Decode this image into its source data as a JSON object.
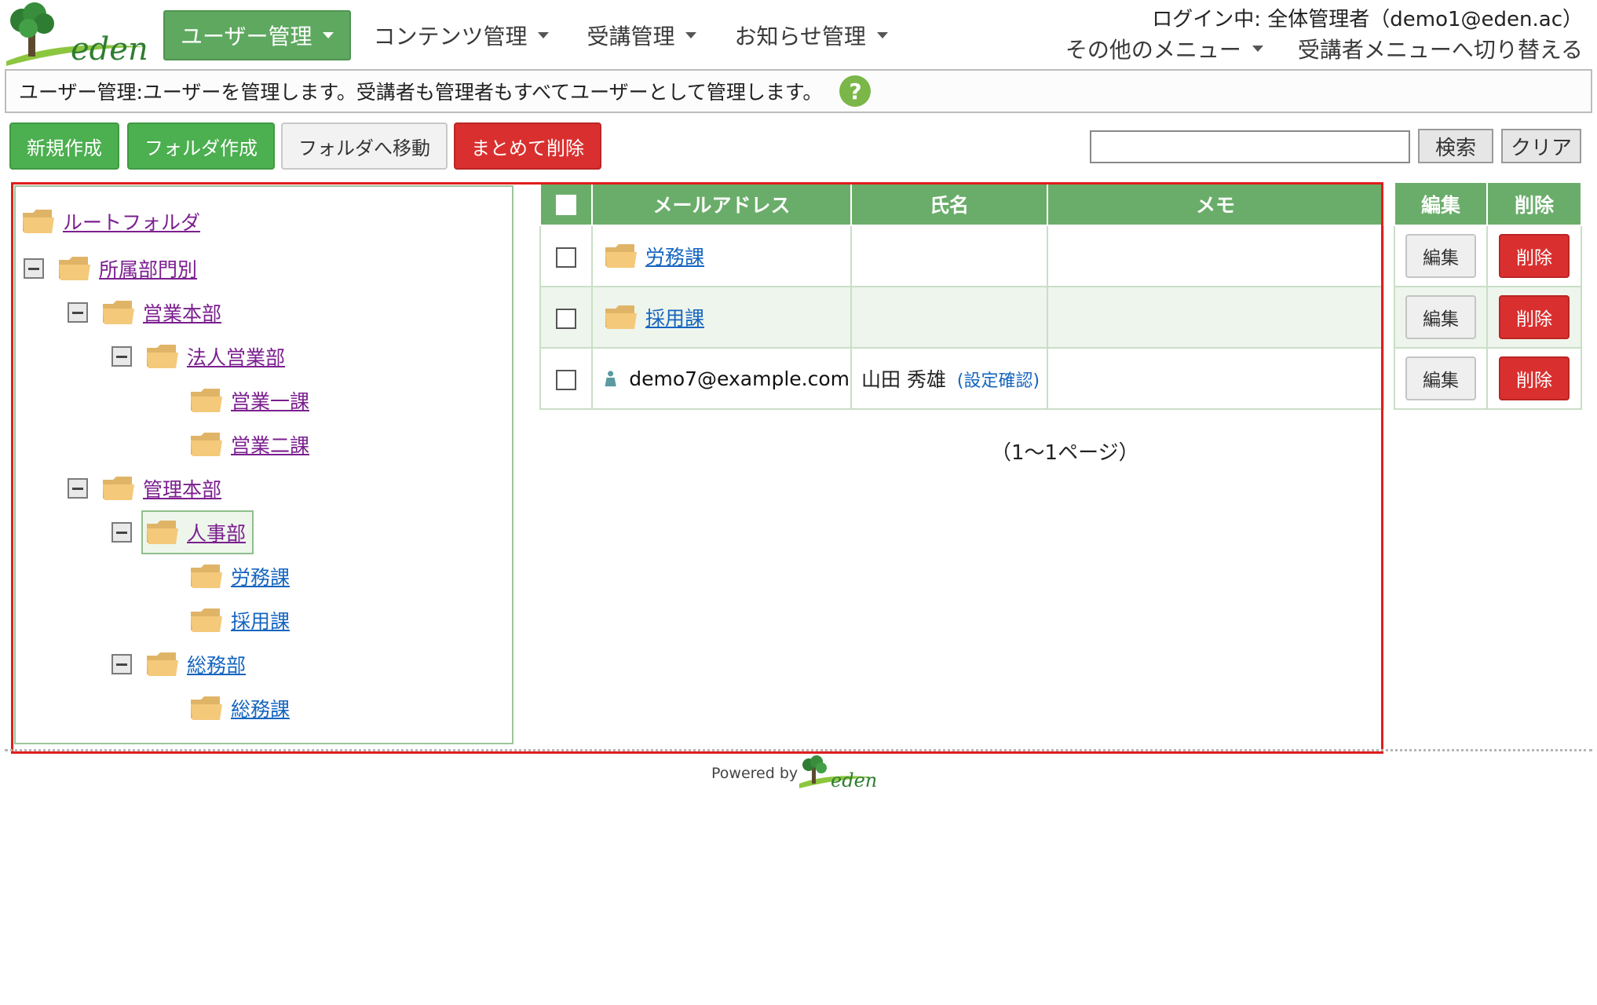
{
  "app": {
    "logo_text": "eden",
    "login_info": "ログイン中: 全体管理者（demo1@eden.ac）"
  },
  "nav": {
    "items": [
      {
        "label": "ユーザー管理",
        "active": true
      },
      {
        "label": "コンテンツ管理",
        "active": false
      },
      {
        "label": "受講管理",
        "active": false
      },
      {
        "label": "お知らせ管理",
        "active": false
      }
    ],
    "other_menu": "その他のメニュー",
    "switch_menu": "受講者メニューへ切り替える"
  },
  "description": "ユーザー管理:ユーザーを管理します。受講者も管理者もすべてユーザーとして管理します。",
  "toolbar": {
    "new_label": "新規作成",
    "new_folder_label": "フォルダ作成",
    "move_label": "フォルダへ移動",
    "bulk_delete_label": "まとめて削除",
    "search_value": "",
    "search_label": "検索",
    "clear_label": "クリア"
  },
  "tree": {
    "root": "ルートフォルダ",
    "affiliation": "所属部門別",
    "sales_hq": "営業本部",
    "corp_sales": "法人営業部",
    "sales1": "営業一課",
    "sales2": "営業二課",
    "admin_hq": "管理本部",
    "hr": "人事部",
    "labor": "労務課",
    "recruit": "採用課",
    "general_affairs": "総務部",
    "general_section": "総務課"
  },
  "table": {
    "headers": {
      "email": "メールアドレス",
      "name": "氏名",
      "memo": "メモ",
      "edit": "編集",
      "delete": "削除"
    },
    "rows": [
      {
        "type": "folder",
        "email": "労務課",
        "name": "",
        "settings": "",
        "memo": "",
        "edit": "編集",
        "delete": "削除"
      },
      {
        "type": "folder",
        "email": "採用課",
        "name": "",
        "settings": "",
        "memo": "",
        "edit": "編集",
        "delete": "削除"
      },
      {
        "type": "user",
        "email": "demo7@example.com",
        "name": "山田 秀雄",
        "settings": "(設定確認)",
        "memo": "",
        "edit": "編集",
        "delete": "削除"
      }
    ]
  },
  "pager": "（1～1ページ）",
  "footer": {
    "powered_by": "Powered by",
    "logo_text": "eden"
  },
  "colors": {
    "nav_active": "#5fa860",
    "header_green": "#6aad6a",
    "button_green": "#4caf50",
    "danger": "#d9302f",
    "highlight": "#e01e1e"
  }
}
